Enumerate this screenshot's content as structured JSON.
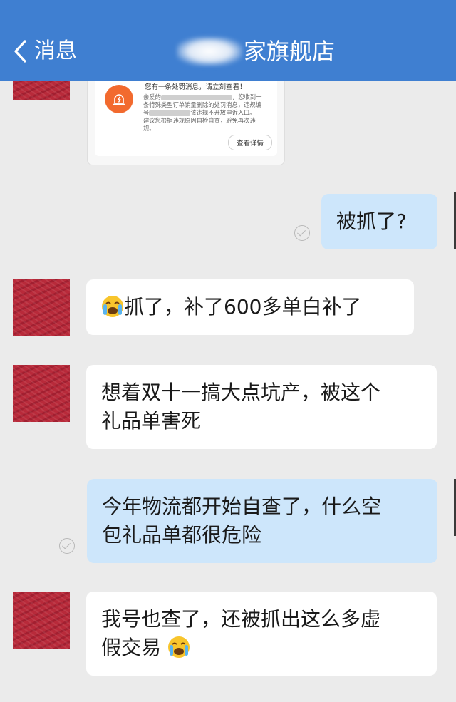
{
  "header": {
    "back_label": "消息",
    "shop_title": "家旗舰店"
  },
  "notice_card": {
    "title": "您有一条处罚消息，请立刻查看！",
    "line1_prefix": "亲爱的",
    "line1_suffix": "，您收到一",
    "line2": "条特殊类型订单销量删除的处罚消息，违规编",
    "line3_prefix": "号",
    "line3_suffix": "该违规不开放申诉入口。",
    "line4": "建议您根据违规原因自检自查，避免再次违",
    "line5": "规。",
    "button_label": "查看详情"
  },
  "messages": [
    {
      "side": "out",
      "text": "被抓了?"
    },
    {
      "side": "in",
      "text": "抓了，补了600多单白补了",
      "emoji": "loudly-crying-face"
    },
    {
      "side": "in",
      "line1": "想着双十一搞大点坑产，被这个",
      "line2": "礼品单害死"
    },
    {
      "side": "out",
      "line1": "今年物流都开始自查了，什么空",
      "line2": "包礼品单都很危险"
    },
    {
      "side": "in",
      "line1": "我号也查了，还被抓出这么多虚",
      "line2": "假交易",
      "emoji": "loudly-crying-face"
    }
  ],
  "colors": {
    "header_bg": "#3f7fd1",
    "background": "#ebebeb",
    "incoming_bubble": "#ffffff",
    "outgoing_bubble": "#cde6fb",
    "notice_icon": "#f26a2e",
    "avatar": "#b82a3a"
  }
}
